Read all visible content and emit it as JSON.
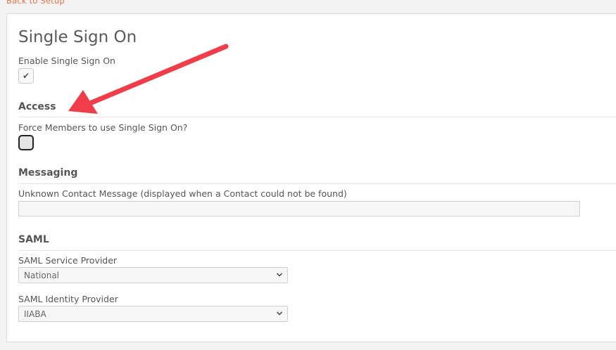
{
  "nav": {
    "back_label": "Back to Setup"
  },
  "page": {
    "title": "Single Sign On"
  },
  "sso": {
    "enable_label": "Enable Single Sign On",
    "enabled": true
  },
  "access": {
    "heading": "Access",
    "force_label": "Force Members to use Single Sign On?",
    "force_checked": false
  },
  "messaging": {
    "heading": "Messaging",
    "unknown_contact_label": "Unknown Contact Message (displayed when a Contact could not be found)",
    "unknown_contact_value": ""
  },
  "saml": {
    "heading": "SAML",
    "service_provider_label": "SAML Service Provider",
    "service_provider_value": "National",
    "identity_provider_label": "SAML Identity Provider",
    "identity_provider_value": "IIABA"
  },
  "annotation": {
    "arrow_color": "#ef3e4a"
  },
  "icons": {
    "checkbox_mark": "check-icon",
    "select_caret": "chevron-down-icon"
  }
}
